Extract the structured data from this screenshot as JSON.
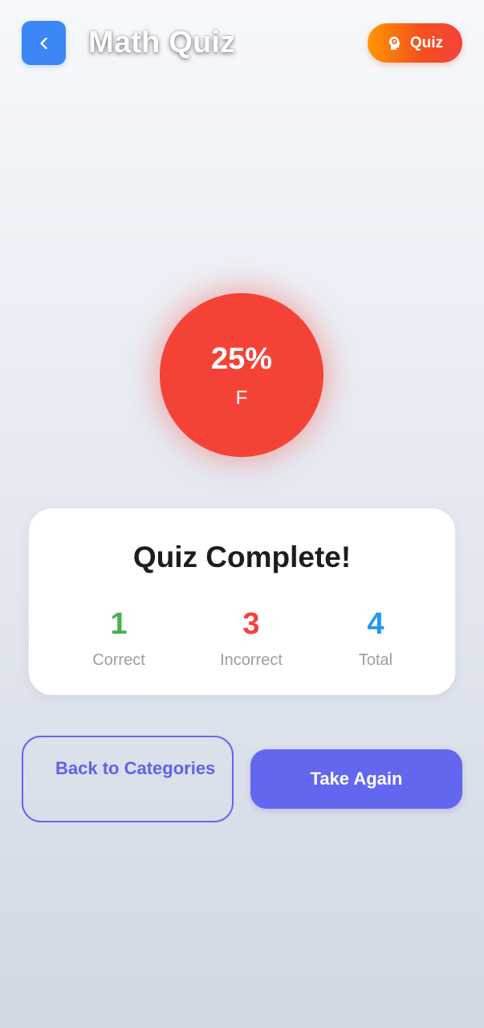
{
  "header": {
    "back_icon": "chevron-left-icon",
    "title": "Math Quiz",
    "badge": {
      "icon": "brain-head-icon",
      "label": "Quiz",
      "colors": [
        "#ff9800",
        "#f4413a"
      ]
    }
  },
  "score": {
    "percent": "25%",
    "grade": "F",
    "color": "#f44336"
  },
  "results": {
    "title": "Quiz Complete!",
    "stats": [
      {
        "value": "1",
        "label": "Correct",
        "color": "#4caf50"
      },
      {
        "value": "3",
        "label": "Incorrect",
        "color": "#f44336"
      },
      {
        "value": "4",
        "label": "Total",
        "color": "#2196f3"
      }
    ]
  },
  "actions": {
    "back_label": "Back to Categories",
    "retake_label": "Take Again",
    "accent": "#6367f0"
  }
}
